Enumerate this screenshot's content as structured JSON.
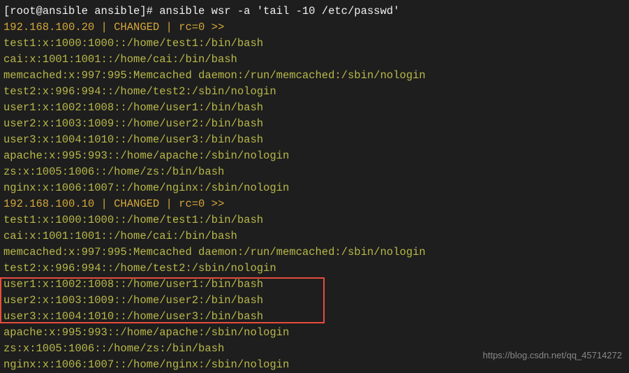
{
  "terminal": {
    "prompt": "[root@ansible ansible]# ansible wsr -a 'tail -10 /etc/passwd'",
    "host1_header": "192.168.100.20 | CHANGED | rc=0 >>",
    "host1_lines": [
      "test1:x:1000:1000::/home/test1:/bin/bash",
      "cai:x:1001:1001::/home/cai:/bin/bash",
      "memcached:x:997:995:Memcached daemon:/run/memcached:/sbin/nologin",
      "test2:x:996:994::/home/test2:/sbin/nologin",
      "user1:x:1002:1008::/home/user1:/bin/bash",
      "user2:x:1003:1009::/home/user2:/bin/bash",
      "user3:x:1004:1010::/home/user3:/bin/bash",
      "apache:x:995:993::/home/apache:/sbin/nologin",
      "zs:x:1005:1006::/home/zs:/bin/bash",
      "nginx:x:1006:1007::/home/nginx:/sbin/nologin"
    ],
    "host2_header": "192.168.100.10 | CHANGED | rc=0 >>",
    "host2_lines": [
      "test1:x:1000:1000::/home/test1:/bin/bash",
      "cai:x:1001:1001::/home/cai:/bin/bash",
      "memcached:x:997:995:Memcached daemon:/run/memcached:/sbin/nologin",
      "test2:x:996:994::/home/test2:/sbin/nologin",
      "user1:x:1002:1008::/home/user1:/bin/bash",
      "user2:x:1003:1009::/home/user2:/bin/bash",
      "user3:x:1004:1010::/home/user3:/bin/bash",
      "apache:x:995:993::/home/apache:/sbin/nologin",
      "zs:x:1005:1006::/home/zs:/bin/bash",
      "nginx:x:1006:1007::/home/nginx:/sbin/nologin"
    ]
  },
  "watermark": "https://blog.csdn.net/qq_45714272"
}
